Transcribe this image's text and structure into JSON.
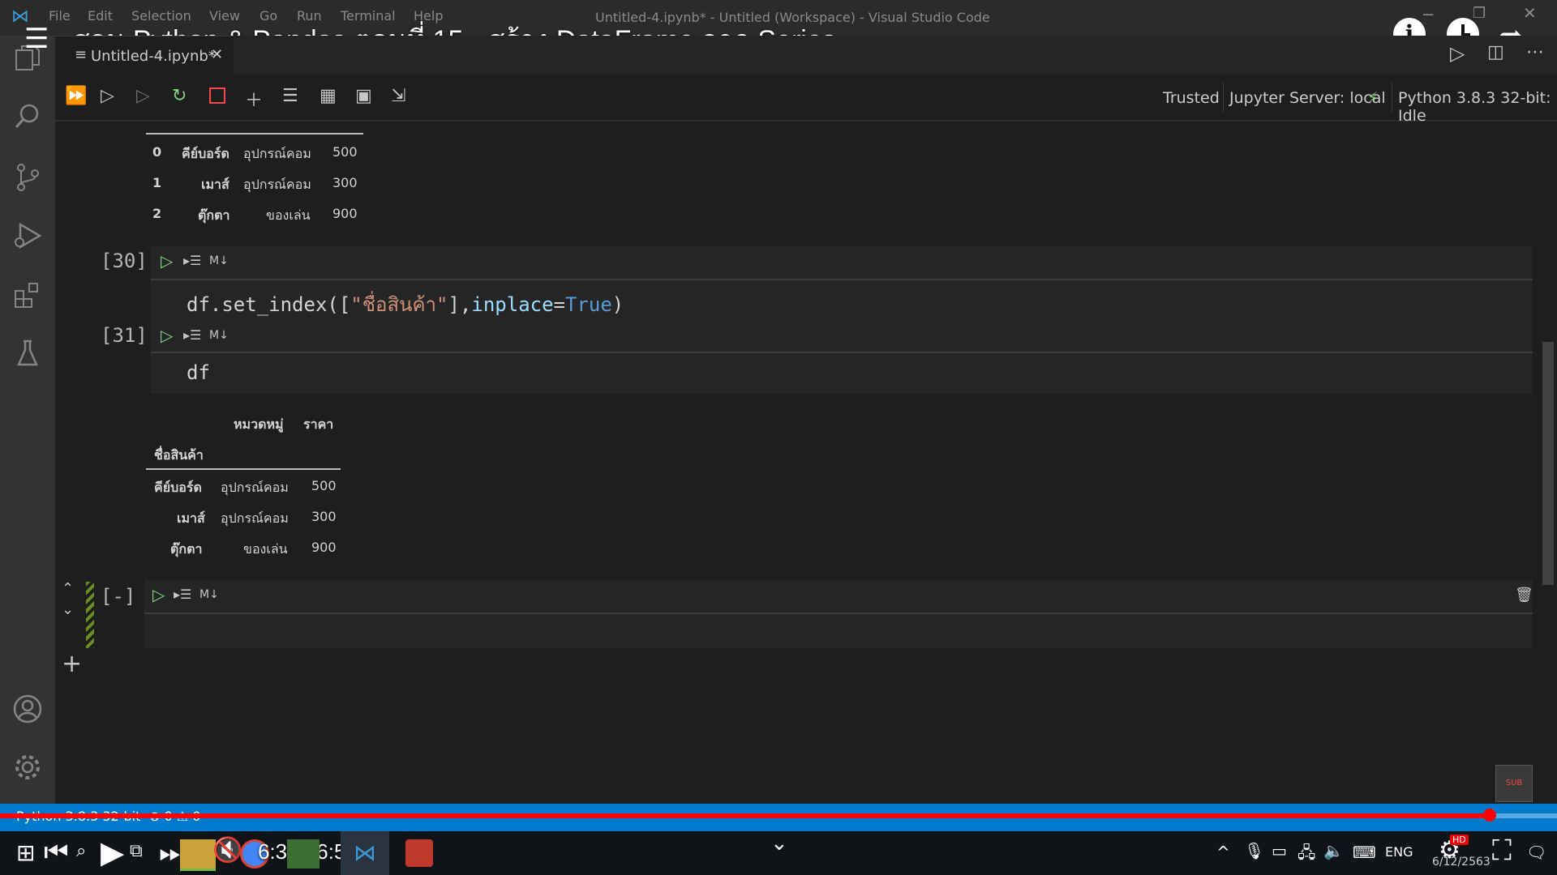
{
  "app": {
    "window_title": "Untitled-4.ipynb* - Untitled (Workspace) - Visual Studio Code",
    "menu": [
      "File",
      "Edit",
      "Selection",
      "View",
      "Go",
      "Run",
      "Terminal",
      "Help"
    ]
  },
  "video": {
    "title": "สอน Python & Pandas ตอนที่ 15 - สร้าง DataFrame จาก Series",
    "time_display": "6:39 / 6:57",
    "progress": 0.9568
  },
  "tab": {
    "label": "Untitled-4.ipynb*"
  },
  "toolbar": {
    "trusted": "Trusted",
    "jupyter_server": "Jupyter Server: local",
    "kernel": "Python 3.8.3 32-bit: Idle"
  },
  "cells": {
    "top_output": {
      "rows": [
        {
          "idx": "0",
          "name": "คีย์บอร์ด",
          "cat": "อุปกรณ์คอม",
          "price": "500"
        },
        {
          "idx": "1",
          "name": "เมาส์",
          "cat": "อุปกรณ์คอม",
          "price": "300"
        },
        {
          "idx": "2",
          "name": "ตุ๊กตา",
          "cat": "ของเล่น",
          "price": "900"
        }
      ]
    },
    "cell30": {
      "count": "[30]",
      "md_label": "M↓",
      "code_a": "df.set_index([",
      "code_str": "\"ชื่อสินค้า\"",
      "code_b": "],",
      "code_attr": "inplace",
      "code_eq": "=",
      "code_bool": "True",
      "code_c": ")"
    },
    "cell31": {
      "count": "[31]",
      "md_label": "M↓",
      "code": "df"
    },
    "output31": {
      "col_cat": "หมวดหมู่",
      "col_price": "ราคา",
      "index_name": "ชื่อสินค้า",
      "rows": [
        {
          "name": "คีย์บอร์ด",
          "cat": "อุปกรณ์คอม",
          "price": "500"
        },
        {
          "name": "เมาส์",
          "cat": "อุปกรณ์คอม",
          "price": "300"
        },
        {
          "name": "ตุ๊กตา",
          "cat": "ของเล่น",
          "price": "900"
        }
      ]
    },
    "new_cell": {
      "count": "[-]",
      "md_label": "M↓"
    }
  },
  "statusbar": {
    "python": "Python 3.8.3 32-bit",
    "problems": "⊗ 0 ⚠ 0"
  },
  "taskbar": {
    "lang": "ENG",
    "date": "6/12/2563"
  },
  "colors": {
    "accent": "#007acc",
    "progress": "#ff0000",
    "run_icon": "#89d185",
    "string": "#ce9178",
    "keyword": "#569cd6"
  }
}
